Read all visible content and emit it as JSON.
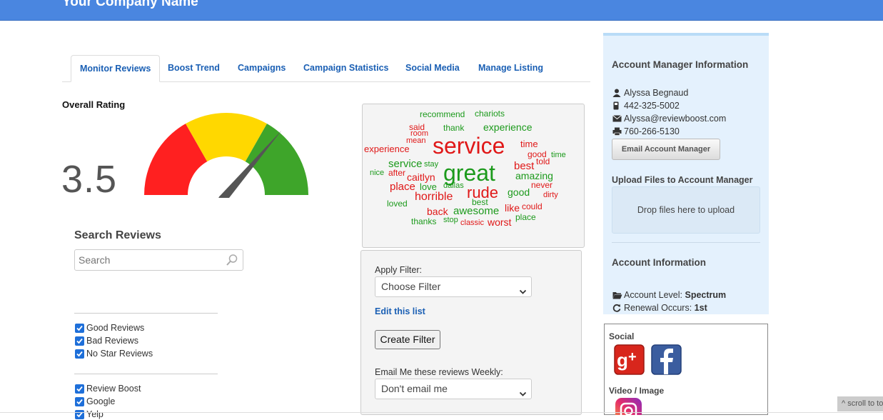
{
  "header": {
    "brand": "Your Company Name"
  },
  "tabs": [
    {
      "label": "Monitor Reviews",
      "active": true
    },
    {
      "label": "Boost Trend"
    },
    {
      "label": "Campaigns"
    },
    {
      "label": "Campaign Statistics"
    },
    {
      "label": "Social Media"
    },
    {
      "label": "Manage Listing"
    }
  ],
  "rating": {
    "label": "Overall Rating",
    "value": "3.5",
    "gauge_value": 3.5,
    "gauge_max": 5,
    "colors": [
      "#ff2020",
      "#ffd800",
      "#3ea52a"
    ]
  },
  "search": {
    "title": "Search Reviews",
    "placeholder": "Search"
  },
  "filters": {
    "group1": [
      "Good Reviews",
      "Bad Reviews",
      "No Star Reviews"
    ],
    "group2": [
      "Review Boost",
      "Google",
      "Yelp"
    ]
  },
  "word_cloud": [
    {
      "t": "recommend",
      "c": "g"
    },
    {
      "t": "chariots",
      "c": "g"
    },
    {
      "t": "said",
      "c": "r"
    },
    {
      "t": "thank",
      "c": "g"
    },
    {
      "t": "experience",
      "c": "g"
    },
    {
      "t": "room",
      "c": "r"
    },
    {
      "t": "mean",
      "c": "r"
    },
    {
      "t": "experience",
      "c": "r"
    },
    {
      "t": "service",
      "c": "r"
    },
    {
      "t": "time",
      "c": "r"
    },
    {
      "t": "good",
      "c": "r"
    },
    {
      "t": "time",
      "c": "g"
    },
    {
      "t": "told",
      "c": "r"
    },
    {
      "t": "service",
      "c": "g"
    },
    {
      "t": "stay",
      "c": "g"
    },
    {
      "t": "great",
      "c": "g"
    },
    {
      "t": "best",
      "c": "r"
    },
    {
      "t": "nice",
      "c": "g"
    },
    {
      "t": "after",
      "c": "r"
    },
    {
      "t": "caitlyn",
      "c": "r"
    },
    {
      "t": "amazing",
      "c": "g"
    },
    {
      "t": "dallas",
      "c": "g"
    },
    {
      "t": "never",
      "c": "r"
    },
    {
      "t": "place",
      "c": "r"
    },
    {
      "t": "love",
      "c": "g"
    },
    {
      "t": "rude",
      "c": "r"
    },
    {
      "t": "good",
      "c": "g"
    },
    {
      "t": "dirty",
      "c": "r"
    },
    {
      "t": "horrible",
      "c": "r"
    },
    {
      "t": "loved",
      "c": "g"
    },
    {
      "t": "best",
      "c": "g"
    },
    {
      "t": "could",
      "c": "r"
    },
    {
      "t": "like",
      "c": "r"
    },
    {
      "t": "back",
      "c": "r"
    },
    {
      "t": "awesome",
      "c": "g"
    },
    {
      "t": "place",
      "c": "g"
    },
    {
      "t": "thanks",
      "c": "g"
    },
    {
      "t": "stop",
      "c": "g"
    },
    {
      "t": "classic",
      "c": "r"
    },
    {
      "t": "worst",
      "c": "r"
    }
  ],
  "filter_panel": {
    "apply_label": "Apply Filter:",
    "choose_placeholder": "Choose Filter",
    "edit_link": "Edit this list",
    "create_button": "Create Filter",
    "email_label": "Email Me these reviews Weekly:",
    "email_value": "Don't email me"
  },
  "account_manager": {
    "title": "Account Manager Information",
    "name": "Alyssa Begnaud",
    "phone": "442-325-5002",
    "email": "Alyssa@reviewboost.com",
    "fax": "760-266-5130",
    "email_button": "Email Account Manager",
    "upload_title": "Upload Files to Account Manager",
    "dropzone": "Drop files here to upload"
  },
  "account_info": {
    "title": "Account Information",
    "level_label": "Account Level:",
    "level_value": "Spectrum",
    "renewal_label": "Renewal Occurs:",
    "renewal_value": "1st"
  },
  "social": {
    "title": "Social",
    "video_title": "Video / Image"
  },
  "scroll_top": "^ scroll to top"
}
